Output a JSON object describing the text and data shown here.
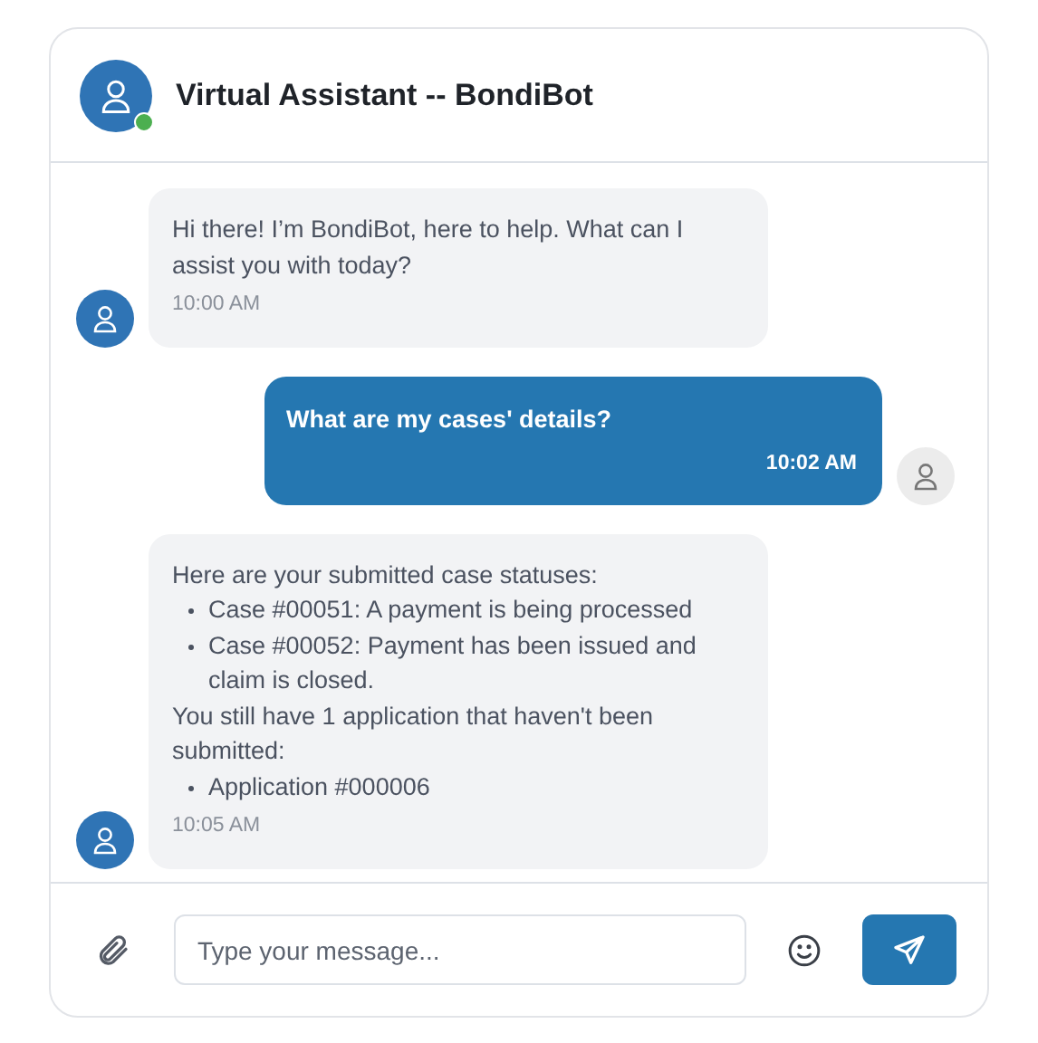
{
  "header": {
    "title": "Virtual Assistant -- BondiBot",
    "online": true
  },
  "messages": [
    {
      "kind": "bot",
      "lines": [
        {
          "kind": "text",
          "text": "Hi there! I’m BondiBot, here to help. What can I assist you with today?"
        }
      ],
      "time": "10:00 AM"
    },
    {
      "kind": "user",
      "lines": [
        {
          "kind": "text",
          "text": "What are my cases' details?"
        }
      ],
      "time": "10:02 AM"
    },
    {
      "kind": "bot",
      "lines": [
        {
          "kind": "text",
          "text": "Here are your submitted case statuses:"
        },
        {
          "kind": "bullet",
          "text": "Case #00051: A payment is being processed"
        },
        {
          "kind": "bullet",
          "text": "Case #00052: Payment has been issued and claim is closed."
        },
        {
          "kind": "text",
          "text": "You still have 1 application that haven't been submitted:"
        },
        {
          "kind": "bullet",
          "text": "Application #000006"
        }
      ],
      "time": "10:05 AM"
    }
  ],
  "composer": {
    "placeholder": "Type your message..."
  }
}
